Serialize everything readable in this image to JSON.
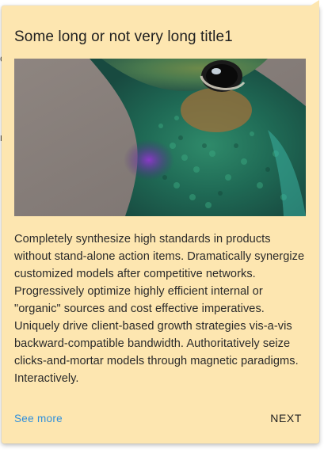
{
  "background": {
    "fragments": [
      "c",
      "r"
    ]
  },
  "tooltip": {
    "title": "Some long or not very long title1",
    "image": {
      "subject": "hummingbird-closeup"
    },
    "body": "Completely synthesize high standards in products without stand-alone action items. Dramatically synergize customized models after competitive networks. Progressively optimize highly efficient internal or \"organic\" sources and cost effective imperatives. Uniquely drive client-based growth strategies vis-a-vis backward-compatible bandwidth. Authoritatively seize clicks-and-mortar models through magnetic paradigms. Interactively.",
    "see_more_label": "See more",
    "next_label": "NEXT"
  },
  "colors": {
    "tooltip_background": "#fde6b0",
    "link": "#2f8fdb",
    "text": "#212121"
  }
}
